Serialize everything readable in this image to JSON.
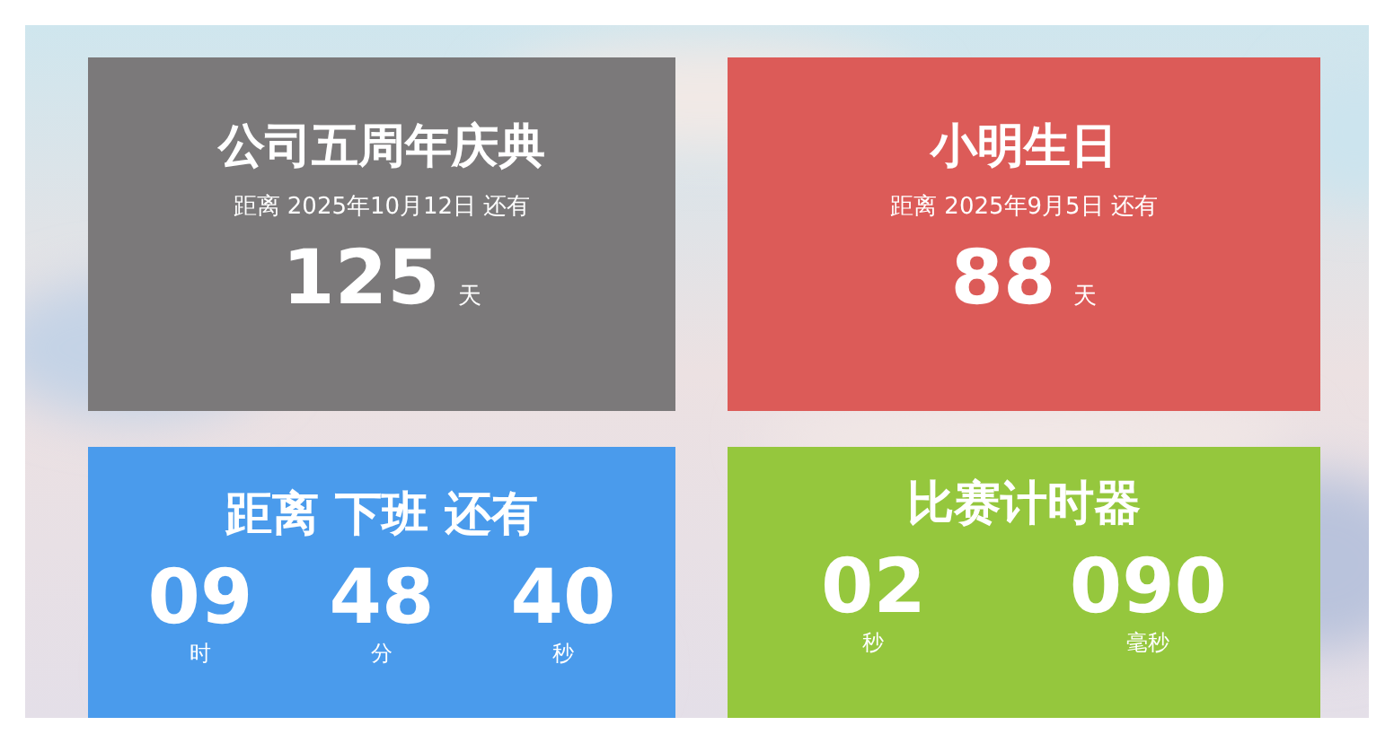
{
  "cards": [
    {
      "kind": "countdown",
      "color": "#7b797a",
      "title": "公司五周年庆典",
      "subtitle": "距离 2025年10月12日 还有",
      "value": "125",
      "unit": "天"
    },
    {
      "kind": "countdown",
      "color": "#dc5b58",
      "title": "小明生日",
      "subtitle": "距离 2025年9月5日 还有",
      "value": "88",
      "unit": "天"
    },
    {
      "kind": "clock",
      "color": "#4a9bec",
      "title": "距离 下班 还有",
      "segments": [
        {
          "value": "09",
          "unit": "时"
        },
        {
          "value": "48",
          "unit": "分"
        },
        {
          "value": "40",
          "unit": "秒"
        }
      ]
    },
    {
      "kind": "clock",
      "color": "#95c73d",
      "title": "比赛计时器",
      "segments": [
        {
          "value": "02",
          "unit": "秒"
        },
        {
          "value": "090",
          "unit": "毫秒"
        }
      ]
    }
  ]
}
